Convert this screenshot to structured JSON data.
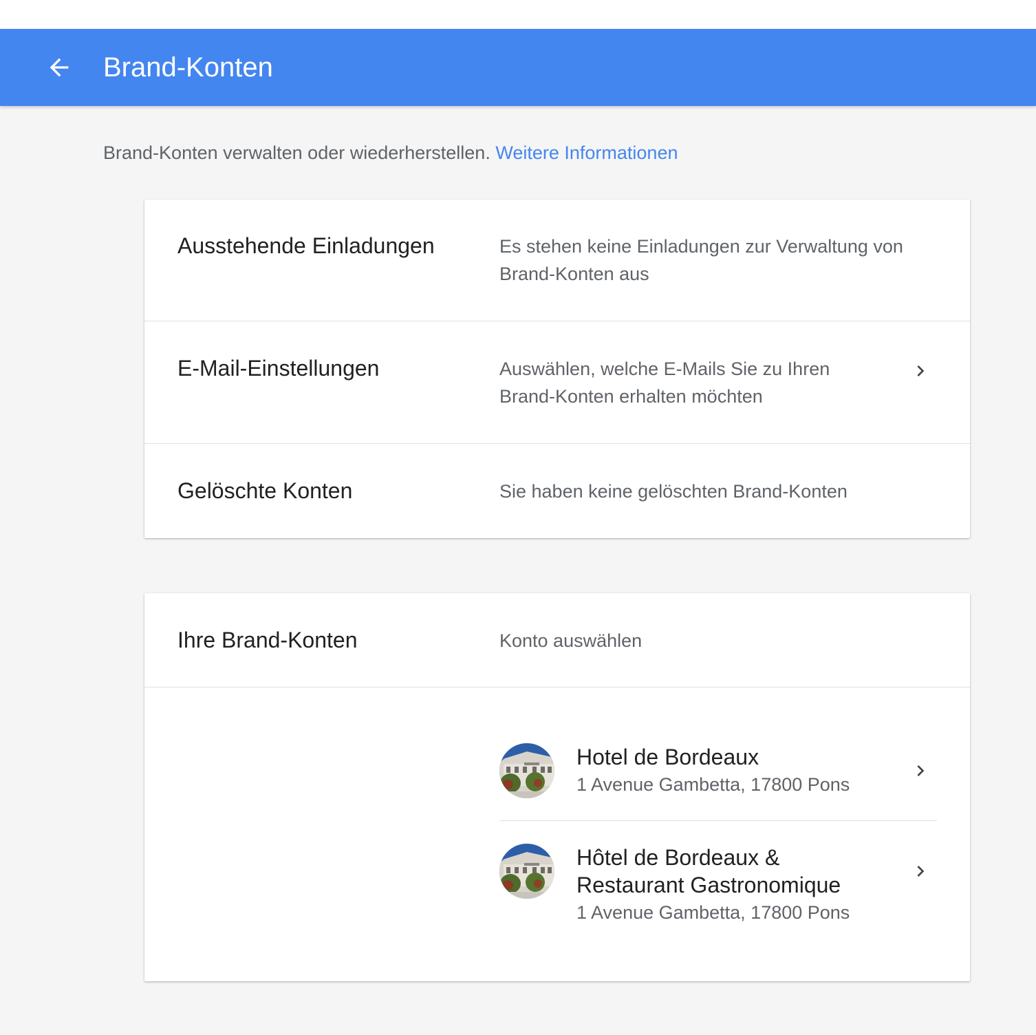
{
  "header": {
    "title": "Brand-Konten"
  },
  "intro": {
    "text": "Brand-Konten verwalten oder wiederherstellen.",
    "link": "Weitere Informationen"
  },
  "settings": {
    "pending": {
      "label": "Ausstehende Einladungen",
      "value": "Es stehen keine Einladungen zur Verwaltung von Brand-Konten aus"
    },
    "email": {
      "label": "E-Mail-Einstellungen",
      "value": "Auswählen, welche E-Mails Sie zu Ihren Brand-Konten erhalten möchten"
    },
    "deleted": {
      "label": "Gelöschte Konten",
      "value": "Sie haben keine gelöschten Brand-Konten"
    }
  },
  "brand_accounts": {
    "label": "Ihre Brand-Konten",
    "hint": "Konto auswählen",
    "accounts": [
      {
        "name": "Hotel de Bordeaux",
        "address": "1 Avenue Gambetta, 17800 Pons"
      },
      {
        "name": "Hôtel de Bordeaux & Restaurant Gastronomique",
        "address": "1 Avenue Gambetta, 17800 Pons"
      }
    ]
  },
  "colors": {
    "app_bar": "#4486f0",
    "link": "#4486f0",
    "background": "#f5f5f5"
  },
  "icons": {
    "back": "arrow-left-icon",
    "row_action": "chevron-right-icon"
  }
}
